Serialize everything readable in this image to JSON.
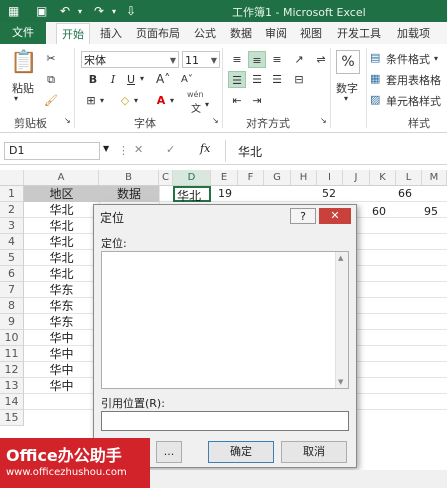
{
  "window": {
    "title": "工作簿1 - Microsoft Excel"
  },
  "ribbon_tabs": [
    "文件",
    "开始",
    "插入",
    "页面布局",
    "公式",
    "数据",
    "审阅",
    "视图",
    "开发工具",
    "加载项"
  ],
  "ribbon": {
    "clipboard": {
      "paste_label": "粘贴",
      "group_label": "剪贴板"
    },
    "font": {
      "name": "宋体",
      "size": "11",
      "font_size_up": "A",
      "font_size_down": "A",
      "wen": "wén",
      "group_label": "字体"
    },
    "alignment": {
      "group_label": "对齐方式"
    },
    "number": {
      "label": "数字",
      "percent": "%"
    },
    "styles": {
      "conditional": "条件格式",
      "table_format": "套用表格格",
      "cell_style": "单元格样式",
      "group_label": "样式"
    }
  },
  "formula_bar": {
    "name_box": "D1",
    "fx": "fx",
    "content": "华北"
  },
  "columns": [
    "A",
    "B",
    "C",
    "D",
    "E",
    "F",
    "G",
    "H",
    "I",
    "J",
    "K",
    "L",
    "M"
  ],
  "selected_column": "D",
  "rows": [
    "1",
    "2",
    "3",
    "4",
    "5",
    "6",
    "7",
    "8",
    "9",
    "10",
    "11",
    "12",
    "13",
    "14",
    "15"
  ],
  "column_a": [
    "地区",
    "华北",
    "华北",
    "华北",
    "华北",
    "华北",
    "华东",
    "华东",
    "华东",
    "华中",
    "华中",
    "华中",
    "华中"
  ],
  "b1": "数据",
  "d1": "华北",
  "e1": "19",
  "j1": "52",
  "l1": "66",
  "k2": "60",
  "m2": "95",
  "dialog": {
    "title": "定位",
    "help": "?",
    "close": "✕",
    "goto_label": "定位:",
    "reference_label": "引用位置(R):",
    "reference_value": "",
    "special_button": "...",
    "ok_button": "确定",
    "cancel_button": "取消"
  },
  "watermark": {
    "brand": "Office办公助手",
    "url": "www.officezhushou.com"
  },
  "colors": {
    "excel_green": "#217346",
    "title_bar": "#1f7145",
    "close_red": "#c8413b",
    "logo_red": "#d2232a"
  }
}
